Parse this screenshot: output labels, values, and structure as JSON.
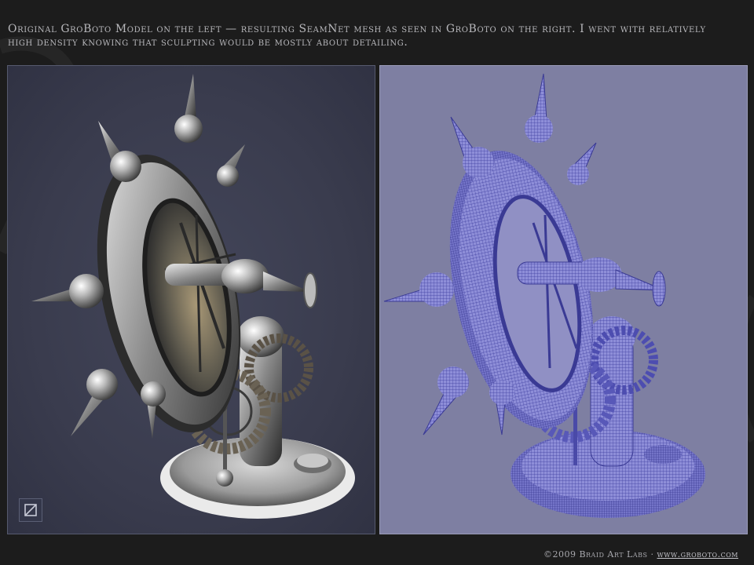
{
  "caption": "Original GroBoto Model on the left — resulting SeamNet mesh as seen in GroBoto on the right. I went with relatively high density knowing that sculpting would be mostly about detailing.",
  "footer": {
    "copyright": "©2009 Braid Art Labs · ",
    "link": "www.groboto.com"
  },
  "colors": {
    "page_background": "#1c1c1c",
    "left_panel": "#3c3e50",
    "right_panel": "#7e7fa2",
    "mesh": "#3f3f9a"
  },
  "icons": {
    "logo": "groboto-logo-icon"
  }
}
